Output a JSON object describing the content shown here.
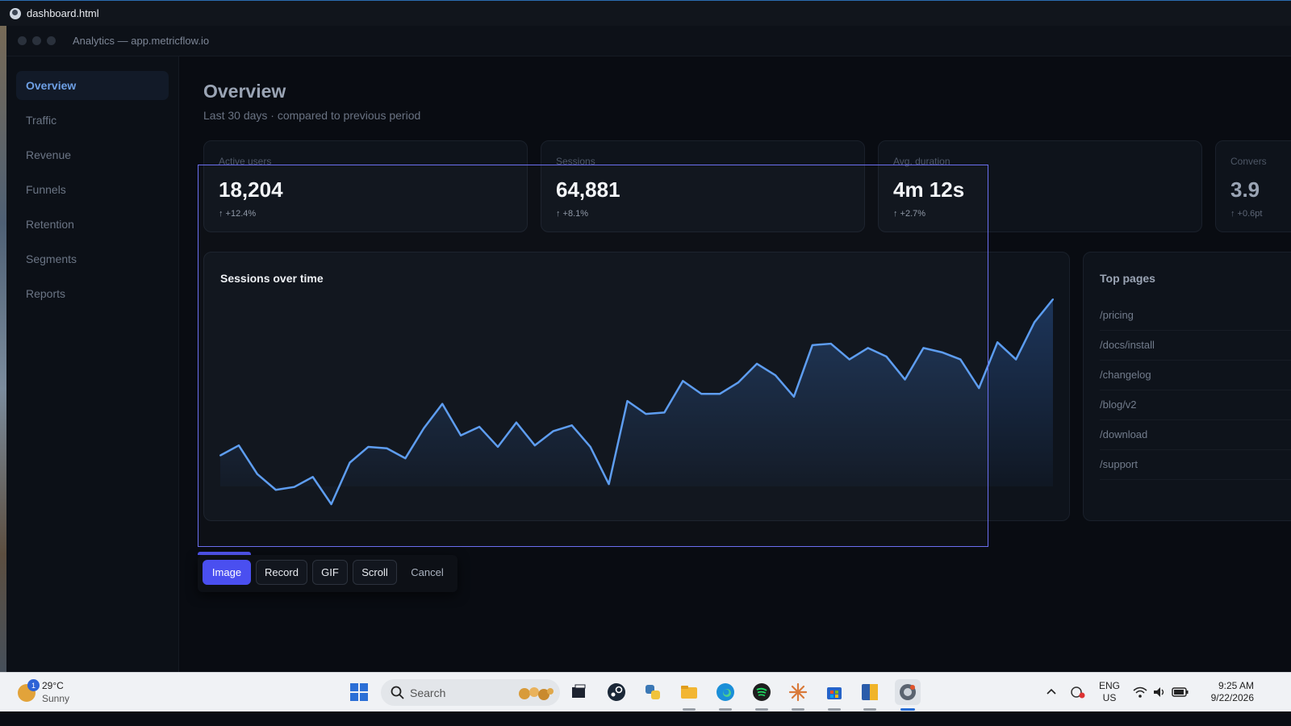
{
  "window": {
    "title": "dashboard.html"
  },
  "browser": {
    "url_text": "Analytics — app.metricflow.io"
  },
  "sidebar": {
    "items": [
      {
        "label": "Overview",
        "active": true
      },
      {
        "label": "Traffic"
      },
      {
        "label": "Revenue"
      },
      {
        "label": "Funnels"
      },
      {
        "label": "Retention"
      },
      {
        "label": "Segments"
      },
      {
        "label": "Reports"
      }
    ]
  },
  "main": {
    "title": "Overview",
    "subtitle": "Last 30 days · compared to previous period",
    "kpis": [
      {
        "label": "Active users",
        "value": "18,204",
        "delta": "↑ +12.4%"
      },
      {
        "label": "Sessions",
        "value": "64,881",
        "delta": "↑ +8.1%"
      },
      {
        "label": "Avg. duration",
        "value": "4m 12s",
        "delta": "↑ +2.7%"
      },
      {
        "label": "Convers",
        "value": "3.9",
        "delta": "↑ +0.6pt"
      }
    ],
    "chart_title": "Sessions over time",
    "top_pages": {
      "title": "Top pages",
      "rows": [
        "/pricing",
        "/docs/install",
        "/changelog",
        "/blog/v2",
        "/download",
        "/support"
      ]
    }
  },
  "chart_data": {
    "type": "area",
    "title": "Sessions over time",
    "x": [
      1,
      2,
      3,
      4,
      5,
      6,
      7,
      8,
      9,
      10,
      11,
      12,
      13,
      14,
      15,
      16,
      17,
      18,
      19,
      20,
      21,
      22,
      23,
      24,
      25,
      26,
      27,
      28,
      29,
      30,
      31,
      32,
      33,
      34,
      35,
      36,
      37,
      38,
      39,
      40,
      41,
      42,
      43,
      44,
      45,
      46
    ],
    "series": [
      {
        "values": [
          34,
          41,
          21,
          10,
          12,
          19,
          0,
          29,
          40,
          39,
          32,
          53,
          70,
          48,
          54,
          40,
          57,
          41,
          51,
          55,
          40,
          14,
          72,
          63,
          64,
          86,
          77,
          77,
          85,
          98,
          90,
          75,
          111,
          112,
          101,
          109,
          103,
          87,
          109,
          106,
          101,
          81,
          113,
          101,
          127,
          143
        ]
      }
    ],
    "grid": false,
    "legend": "none",
    "colors": {
      "line": "#5b9cf0"
    }
  },
  "capture_toolbar": {
    "buttons": [
      {
        "label": "Image",
        "active": true
      },
      {
        "label": "Record"
      },
      {
        "label": "GIF"
      },
      {
        "label": "Scroll"
      },
      {
        "label": "Cancel"
      }
    ]
  },
  "taskbar": {
    "weather_badge": "1",
    "temperature": "29°C",
    "condition": "Sunny",
    "search_label": "Search",
    "lang_line1": "ENG",
    "lang_line2": "US",
    "time": "9:25 AM",
    "date": "9/22/2026",
    "icons": [
      "start-icon",
      "search-icon",
      "task-view-icon",
      "steam-icon",
      "python-icon",
      "file-explorer-icon",
      "edge-icon",
      "spotify-icon",
      "claude-icon",
      "store-icon",
      "app-icon",
      "screenshot-tool-icon"
    ]
  }
}
